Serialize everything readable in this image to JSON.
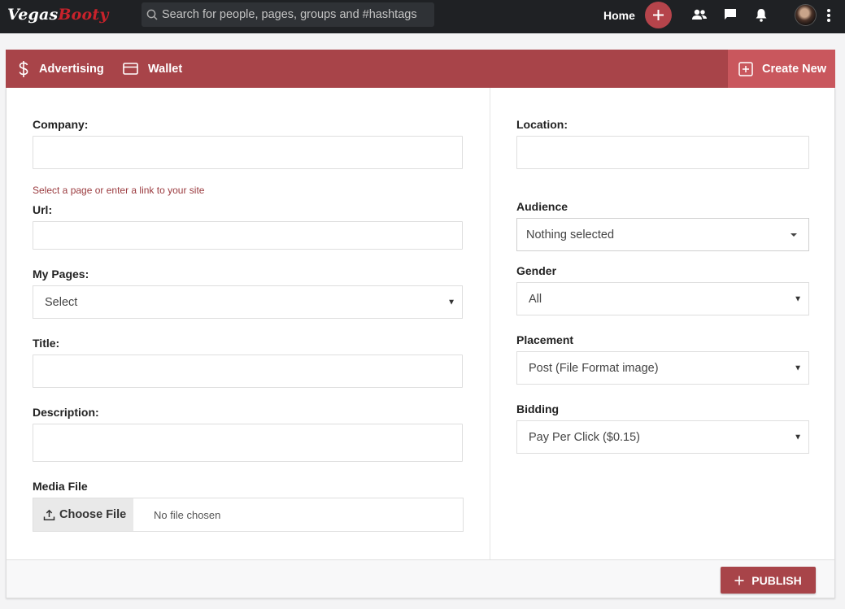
{
  "topbar": {
    "logo_part1": "Vegas",
    "logo_part2": "Booty",
    "search_placeholder": "Search for people, pages, groups and #hashtags",
    "home_label": "Home",
    "icons": [
      "search-icon",
      "plus-icon",
      "friends-icon",
      "messages-icon",
      "notifications-icon",
      "avatar",
      "more-vertical-icon"
    ]
  },
  "adbar": {
    "advertising_label": "Advertising",
    "wallet_label": "Wallet",
    "create_new_label": "Create New"
  },
  "form": {
    "company_label": "Company:",
    "url_hint": "Select a page or enter a link to your site",
    "url_label": "Url:",
    "my_pages_label": "My Pages:",
    "my_pages_value": "Select",
    "title_label": "Title:",
    "description_label": "Description:",
    "media_file_label": "Media File",
    "choose_file_label": "Choose File",
    "no_file_text": "No file chosen",
    "location_label": "Location:",
    "audience_label": "Audience",
    "audience_value": "Nothing selected",
    "gender_label": "Gender",
    "gender_value": "All",
    "placement_label": "Placement",
    "placement_value": "Post (File Format image)",
    "bidding_label": "Bidding",
    "bidding_value": "Pay Per Click ($0.15)",
    "publish_label": "PUBLISH"
  },
  "colors": {
    "accent": "#a84449",
    "accent_light": "#c9575d",
    "topbar_bg": "#1f2124",
    "logo_red": "#c8222b"
  }
}
